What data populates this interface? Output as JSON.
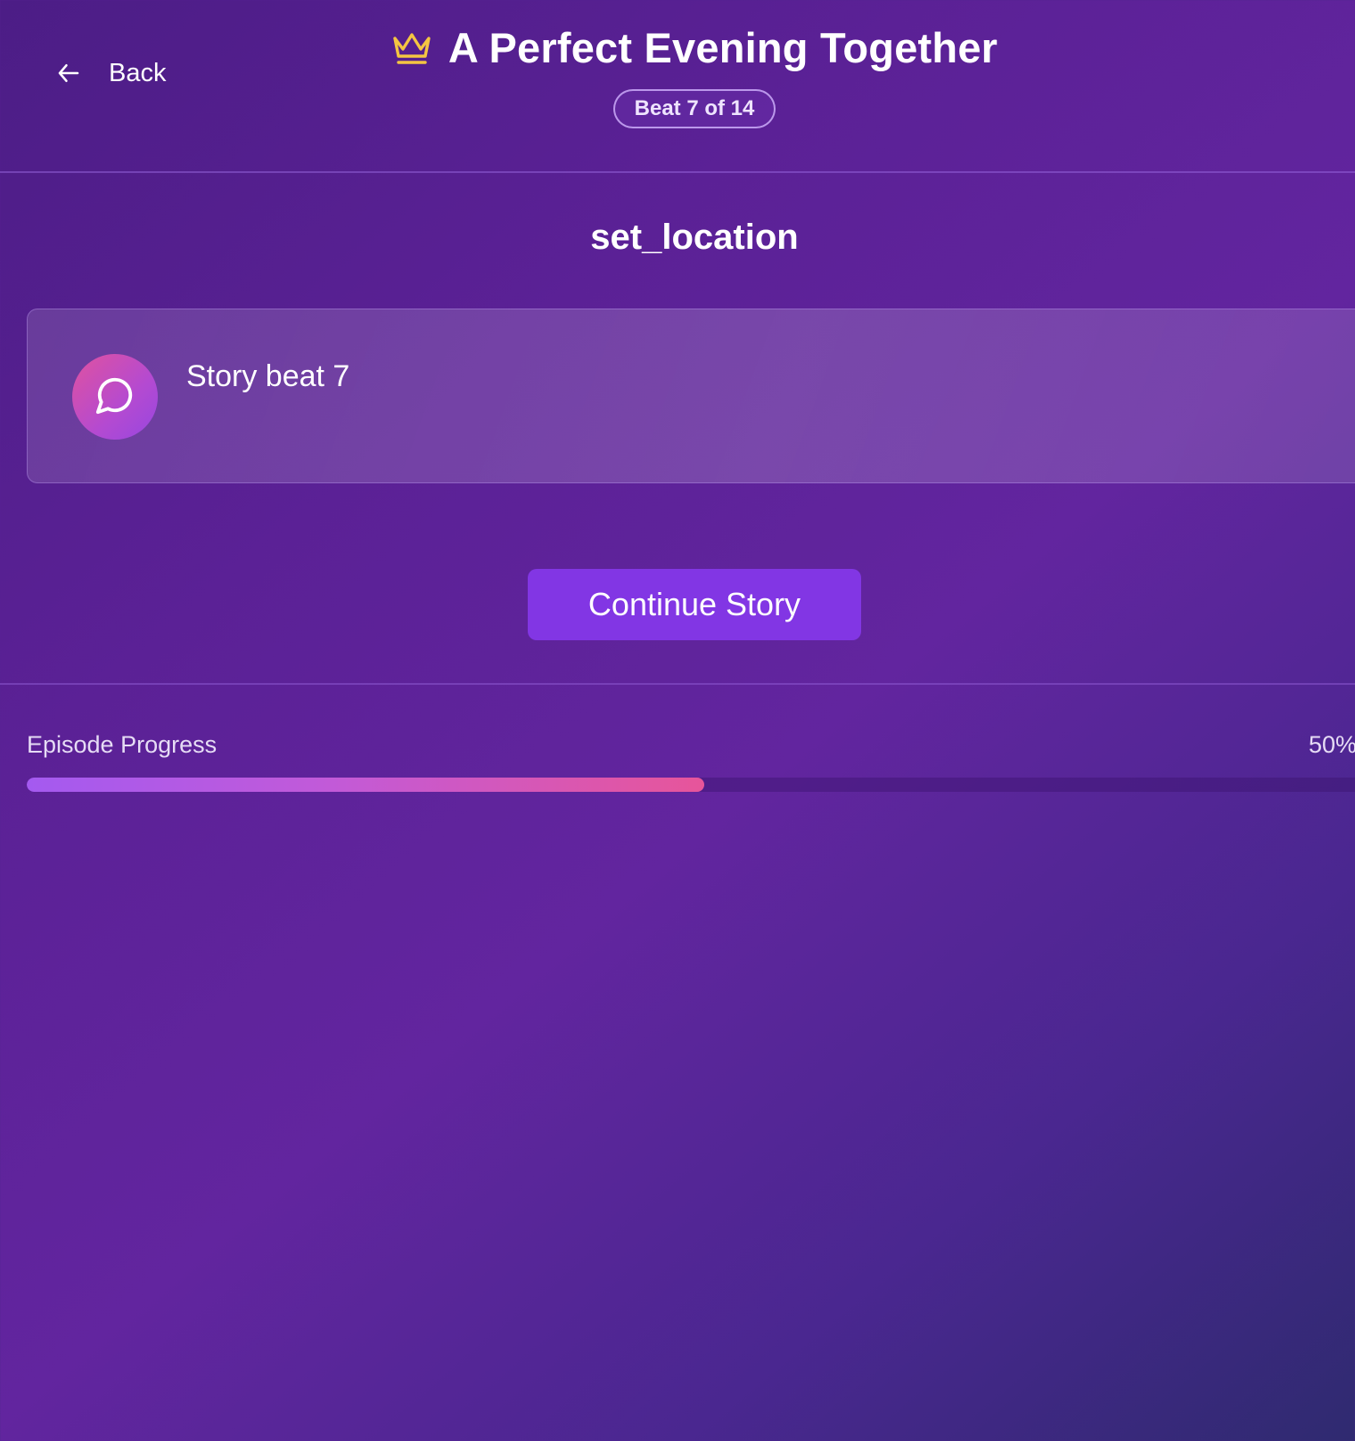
{
  "header": {
    "back_label": "Back",
    "title": "A Perfect Evening Together",
    "badge": "Beat 7 of 14"
  },
  "icons": {
    "back": "arrow-left-icon",
    "crown": "crown-icon",
    "chat": "chat-bubble-icon"
  },
  "beat": {
    "title": "set_location",
    "text": "Story beat 7",
    "continue_label": "Continue Story"
  },
  "progress": {
    "label": "Episode Progress",
    "percent_text": "50%",
    "fraction": 0.5
  },
  "colors": {
    "accent": "#8236e4",
    "crown": "#f4c542",
    "progress_start": "#a45af0",
    "progress_end": "#e7559a"
  }
}
